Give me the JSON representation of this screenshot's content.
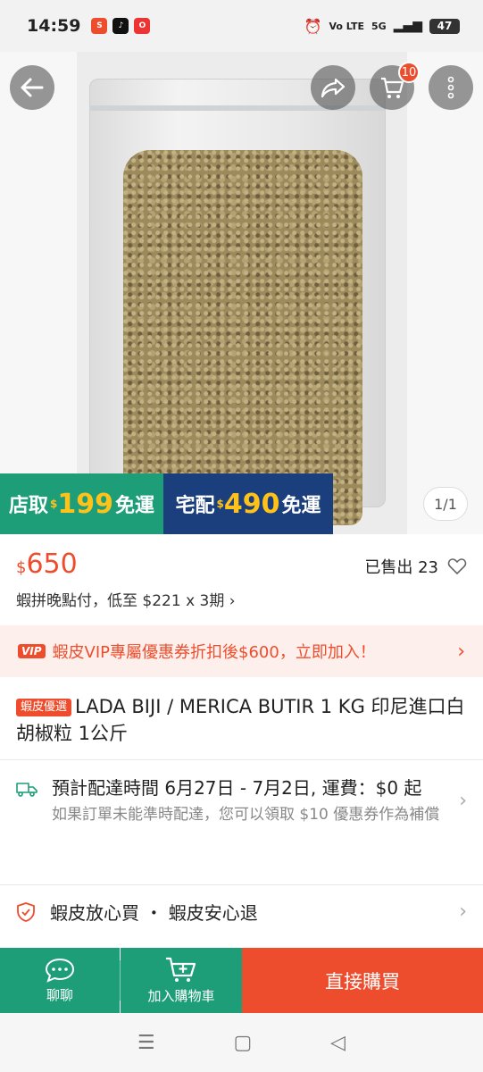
{
  "status_bar": {
    "time": "14:59",
    "network_label": "Vo LTE",
    "signal_label": "5G",
    "battery": "47"
  },
  "header": {
    "cart_count": "10"
  },
  "product": {
    "image_icon": "pepper-bag-photo",
    "promo": {
      "store_label": "店取",
      "store_currency": "$",
      "store_amount": "199",
      "store_suffix": "免運",
      "home_label": "宅配",
      "home_currency": "$",
      "home_amount": "490",
      "home_suffix": "免運"
    },
    "page_indicator": "1/1",
    "currency": "$",
    "price": "650",
    "sold": "已售出 23",
    "installment": "蝦拼晚點付，低至 $221 x 3期",
    "vip_logo": "VIP",
    "vip_text": "蝦皮VIP專屬優惠券折扣後$600，立即加入！",
    "mall_tag": "蝦皮優選",
    "title": "LADA BIJI / MERICA BUTIR 1 KG 印尼進口白胡椒粒 1公斤"
  },
  "shipping": {
    "main": "預計配達時間 6月27日 - 7月2日, 運費：$0 起",
    "sub": "如果訂單未能準時配達，您可以領取 $10 優惠券作為補償"
  },
  "guarantee": {
    "text": "蝦皮放心買 ・ 蝦皮安心退"
  },
  "bottom_bar": {
    "chat_label": "聊聊",
    "add_cart_label": "加入購物車",
    "buy_label": "直接購買"
  },
  "colors": {
    "brand": "#ee4d2d",
    "green": "#1e9e78",
    "navy": "#1b3f7c",
    "promo_yellow": "#ffc21a"
  }
}
